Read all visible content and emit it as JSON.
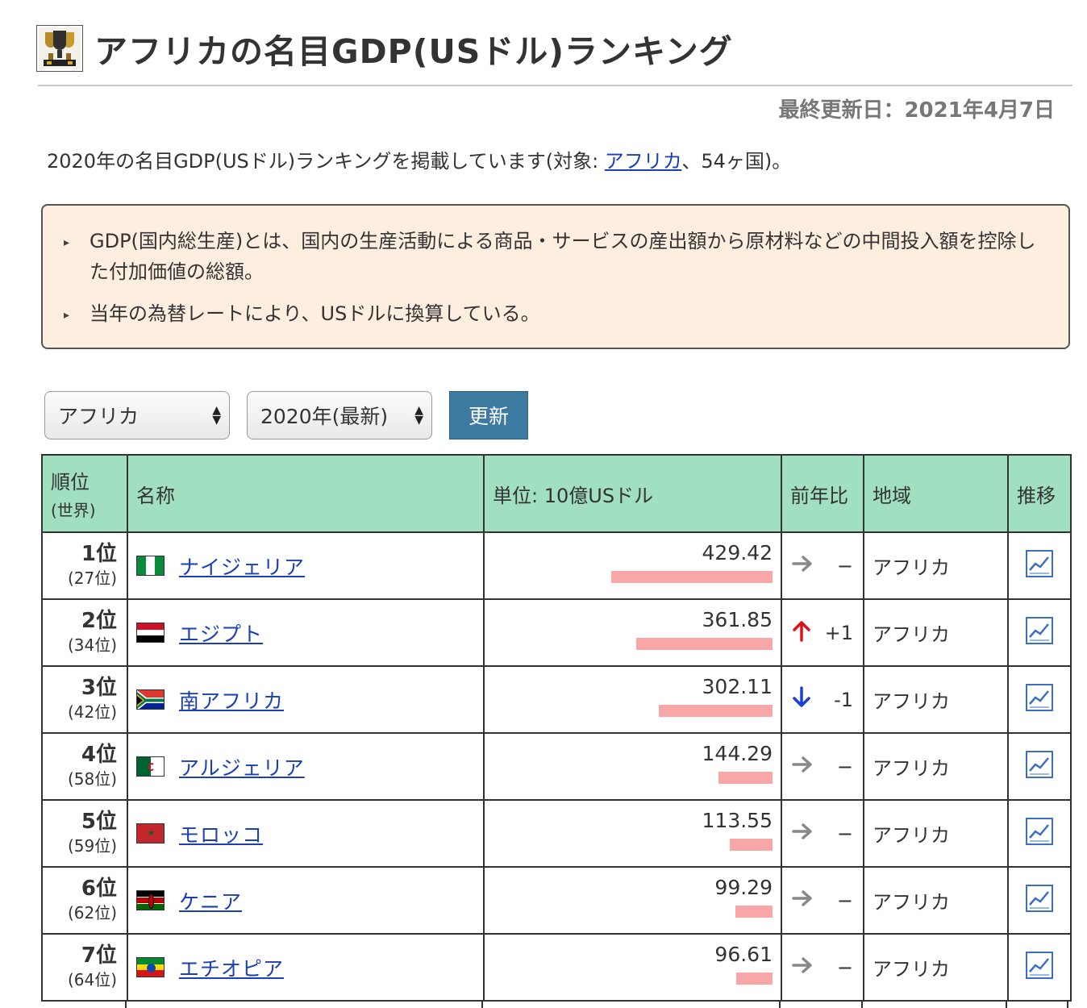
{
  "page": {
    "title": "アフリカの名目GDP(USドル)ランキング",
    "updated": "最終更新日：2021年4月7日",
    "intro_prefix": "2020年の名目GDP(USドル)ランキングを掲載しています(対象: ",
    "intro_link": "アフリカ",
    "intro_suffix": "、54ヶ国)。"
  },
  "notes": [
    "GDP(国内総生産)とは、国内の生産活動による商品・サービスの産出額から原材料などの中間投入額を控除した付加価値の総額。",
    "当年の為替レートにより、USドルに換算している。"
  ],
  "controls": {
    "region_value": "アフリカ",
    "year_value": "2020年(最新)",
    "button_label": "更新"
  },
  "table": {
    "headers": {
      "rank": "順位",
      "rank_sub": "(世界)",
      "name": "名称",
      "unit": "単位: 10億USドル",
      "change": "前年比",
      "region": "地域",
      "trend": "推移"
    },
    "rows": [
      {
        "rank": "1位",
        "world": "(27位)",
        "name": "ナイジェリア",
        "value": "429.42",
        "change": "−",
        "dir": "same",
        "region": "アフリカ"
      },
      {
        "rank": "2位",
        "world": "(34位)",
        "name": "エジプト",
        "value": "361.85",
        "change": "+1",
        "dir": "up",
        "region": "アフリカ"
      },
      {
        "rank": "3位",
        "world": "(42位)",
        "name": "南アフリカ",
        "value": "302.11",
        "change": "-1",
        "dir": "down",
        "region": "アフリカ"
      },
      {
        "rank": "4位",
        "world": "(58位)",
        "name": "アルジェリア",
        "value": "144.29",
        "change": "−",
        "dir": "same",
        "region": "アフリカ"
      },
      {
        "rank": "5位",
        "world": "(59位)",
        "name": "モロッコ",
        "value": "113.55",
        "change": "−",
        "dir": "same",
        "region": "アフリカ"
      },
      {
        "rank": "6位",
        "world": "(62位)",
        "name": "ケニア",
        "value": "99.29",
        "change": "−",
        "dir": "same",
        "region": "アフリカ"
      },
      {
        "rank": "7位",
        "world": "(64位)",
        "name": "エチオピア",
        "value": "96.61",
        "change": "−",
        "dir": "same",
        "region": "アフリカ"
      }
    ]
  },
  "colors": {
    "header_bg": "#a0dfc0",
    "bar": "#f7a7a7",
    "link": "#1a3fb6",
    "up": "#e0101a",
    "down": "#1a3fd6",
    "same": "#888888",
    "button": "#3d7aa1"
  },
  "icons": {
    "title": "trophy-icon",
    "trend": "line-chart-icon",
    "flags": [
      "nigeria-flag-icon",
      "egypt-flag-icon",
      "south-africa-flag-icon",
      "algeria-flag-icon",
      "morocco-flag-icon",
      "kenya-flag-icon",
      "ethiopia-flag-icon"
    ]
  }
}
